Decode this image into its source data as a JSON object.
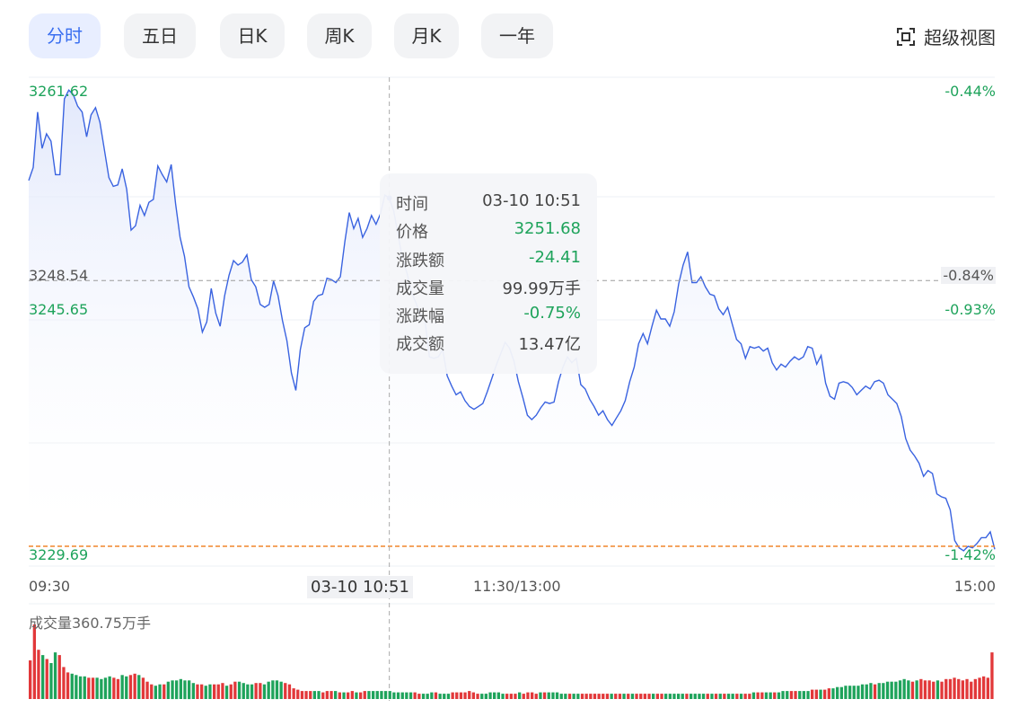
{
  "tabs": [
    {
      "label": "分时",
      "active": true
    },
    {
      "label": "五日",
      "active": false
    },
    {
      "label": "日K",
      "active": false
    },
    {
      "label": "周K",
      "active": false
    },
    {
      "label": "月K",
      "active": false
    },
    {
      "label": "一年",
      "active": false
    }
  ],
  "super_view": {
    "label": "超级视图",
    "icon": "expand-view-icon"
  },
  "colors": {
    "line": "#3a63e0",
    "up": "#e2383a",
    "down": "#1ea35b",
    "ref": "#9c9c9c",
    "low": "#f0852c",
    "accent": "#3a6ff0"
  },
  "axis": {
    "price_top": "3261.62",
    "price_mid": "3248.54",
    "price_2": "3245.65",
    "price_bottom": "3229.69",
    "pct_top": "-0.44%",
    "pct_mid": "-0.84%",
    "pct_2": "-0.93%",
    "pct_bottom": "-1.42%",
    "time_start": "09:30",
    "time_mid": "11:30/13:00",
    "time_end": "15:00",
    "crosshair_time": "03-10 10:51"
  },
  "tooltip": {
    "rows": [
      {
        "k": "时间",
        "v": "03-10 10:51"
      },
      {
        "k": "价格",
        "v": "3251.68"
      },
      {
        "k": "涨跌额",
        "v": "-24.41"
      },
      {
        "k": "成交量",
        "v": "99.99万手"
      },
      {
        "k": "涨跌幅",
        "v": "-0.75%"
      },
      {
        "k": "成交额",
        "v": "13.47亿"
      }
    ]
  },
  "volume": {
    "title": "成交量360.75万手"
  },
  "chart_data": {
    "type": "line",
    "ylim": [
      3229.69,
      3261.62
    ],
    "reference_price": 3248.54,
    "low_line": 3229.69,
    "x_range": [
      "09:30",
      "15:00"
    ],
    "series": [
      {
        "values": [
          3255.4,
          3256.3,
          3260.1,
          3257.6,
          3258.6,
          3258.1,
          3255.8,
          3255.8,
          3261.0,
          3261.6,
          3261.3,
          3260.5,
          3260.1,
          3258.4,
          3259.9,
          3260.4,
          3259.4,
          3257.5,
          3255.6,
          3255.0,
          3255.1,
          3256.2,
          3254.8,
          3252.0,
          3252.3,
          3253.7,
          3253.0,
          3253.9,
          3254.1,
          3256.4,
          3255.8,
          3255.3,
          3256.5,
          3253.8,
          3251.5,
          3250.2,
          3248.1,
          3247.4,
          3246.6,
          3245.0,
          3245.7,
          3248.0,
          3246.3,
          3245.4,
          3247.5,
          3248.9,
          3249.9,
          3249.6,
          3249.8,
          3250.3,
          3248.6,
          3248.1,
          3246.9,
          3246.7,
          3246.9,
          3248.5,
          3247.5,
          3245.8,
          3244.4,
          3242.2,
          3241.0,
          3243.8,
          3245.3,
          3245.5,
          3247.1,
          3247.5,
          3247.6,
          3248.7,
          3248.6,
          3248.4,
          3248.8,
          3251.2,
          3253.2,
          3252.1,
          3252.8,
          3251.5,
          3252.1,
          3253.0,
          3252.4,
          3253.1,
          3254.4,
          3254.2,
          3253.3,
          3251.6,
          3250.0,
          3249.0,
          3247.7,
          3247.0,
          3246.1,
          3245.8,
          3243.3,
          3243.2,
          3243.3,
          3243.8,
          3242.0,
          3241.3,
          3240.7,
          3240.9,
          3240.3,
          3239.9,
          3239.7,
          3239.9,
          3240.1,
          3240.9,
          3241.8,
          3242.7,
          3243.5,
          3244.3,
          3243.9,
          3243.0,
          3241.6,
          3240.5,
          3239.3,
          3239.0,
          3239.3,
          3239.8,
          3240.2,
          3240.1,
          3240.2,
          3241.6,
          3242.6,
          3243.3,
          3242.9,
          3243.2,
          3241.4,
          3241.1,
          3240.4,
          3239.9,
          3239.3,
          3239.6,
          3239.0,
          3238.6,
          3239.1,
          3239.6,
          3240.3,
          3241.6,
          3242.6,
          3244.2,
          3244.9,
          3244.2,
          3245.4,
          3246.5,
          3245.9,
          3245.9,
          3245.4,
          3246.4,
          3248.3,
          3249.6,
          3250.5,
          3248.4,
          3248.4,
          3248.8,
          3248.1,
          3247.6,
          3247.5,
          3246.6,
          3246.2,
          3246.7,
          3245.6,
          3244.5,
          3244.2,
          3243.2,
          3244.0,
          3243.9,
          3244.0,
          3243.7,
          3243.9,
          3242.9,
          3242.4,
          3242.8,
          3242.6,
          3243.0,
          3243.3,
          3243.1,
          3243.3,
          3244.0,
          3243.9,
          3242.8,
          3243.4,
          3241.5,
          3240.6,
          3240.4,
          3241.5,
          3241.6,
          3241.5,
          3241.2,
          3240.7,
          3241.0,
          3241.3,
          3241.1,
          3241.6,
          3241.7,
          3241.5,
          3240.7,
          3240.4,
          3240.1,
          3239.2,
          3237.7,
          3236.9,
          3236.5,
          3236.0,
          3235.1,
          3235.5,
          3235.3,
          3233.9,
          3233.7,
          3233.6,
          3232.8,
          3230.7,
          3230.2,
          3230.0,
          3230.3,
          3230.2,
          3230.5,
          3230.9,
          3230.9,
          3231.3,
          3230.1
        ]
      }
    ],
    "volume_bars": {
      "values": [
        29,
        56,
        37,
        33,
        30,
        27,
        35,
        33,
        24,
        20,
        19,
        18,
        17,
        17,
        16,
        16,
        16,
        15,
        16,
        17,
        16,
        15,
        18,
        17,
        18,
        19,
        18,
        16,
        13,
        11,
        10,
        11,
        11,
        13,
        14,
        14,
        15,
        14,
        14,
        12,
        11,
        11,
        10,
        11,
        11,
        11,
        12,
        10,
        11,
        13,
        13,
        12,
        11,
        11,
        12,
        12,
        11,
        13,
        14,
        14,
        13,
        12,
        11,
        8,
        7,
        6,
        6,
        6,
        6,
        6,
        5,
        6,
        6,
        6,
        5,
        5,
        5,
        6,
        5,
        5,
        6,
        6,
        6,
        6,
        6,
        6,
        6,
        5,
        5,
        5,
        5,
        5,
        5,
        4,
        4,
        4,
        5,
        5,
        4,
        4,
        4,
        5,
        5,
        5,
        5,
        6,
        5,
        4,
        4,
        4,
        5,
        5,
        5,
        4,
        4,
        4,
        4,
        5,
        4,
        5,
        5,
        4,
        5,
        5,
        5,
        5,
        5,
        4,
        4,
        4,
        4,
        4,
        4,
        4,
        4,
        4,
        4,
        4,
        4,
        4,
        4,
        4,
        4,
        4,
        4,
        4,
        4,
        4,
        4,
        4,
        4,
        4,
        4,
        4,
        4,
        4,
        4,
        4,
        4,
        4,
        4,
        4,
        4,
        4,
        4,
        4,
        4,
        4,
        4,
        4,
        4,
        4,
        4,
        5,
        5,
        5,
        5,
        5,
        5,
        5,
        6,
        6,
        6,
        6,
        6,
        6,
        6,
        7,
        7,
        7,
        7,
        8,
        8,
        9,
        9,
        10,
        10,
        10,
        10,
        11,
        11,
        12,
        11,
        12,
        12,
        13,
        13,
        13,
        14,
        15,
        14,
        13,
        14,
        15,
        14,
        14,
        13,
        14,
        13,
        15,
        15,
        16,
        15,
        14,
        15,
        13,
        15,
        16,
        17,
        16,
        35
      ]
    }
  }
}
